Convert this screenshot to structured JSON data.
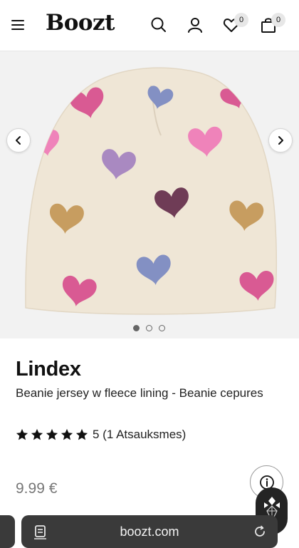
{
  "header": {
    "logo": "Boozt",
    "wishlist_count": "0",
    "cart_count": "0"
  },
  "gallery": {
    "image_alt": "Heart pattern beanie",
    "active_index": 0,
    "total": 3
  },
  "product": {
    "brand": "Lindex",
    "name": "Beanie jersey w fleece lining - Beanie cepures",
    "rating_value": 5,
    "rating_text": "5 (1 Atsauksmes)",
    "price": "9.99 €"
  },
  "browser": {
    "url": "boozt.com"
  },
  "icons": {
    "menu": "hamburger-icon",
    "search": "search-icon",
    "account": "user-icon",
    "wishlist": "heart-icon",
    "cart": "shopping-bag-icon",
    "prev": "chevron-left-icon",
    "next": "chevron-right-icon",
    "info": "info-icon",
    "tabs": "tabs-icon",
    "reload": "reload-icon"
  },
  "colors": {
    "beanie": "#efe6d6",
    "heart_pink": "#d95a93",
    "heart_light_pink": "#ef83ba",
    "heart_lilac": "#a989c1",
    "heart_plum": "#6f3c56",
    "heart_tan": "#c79d60",
    "heart_blue": "#8390c3"
  }
}
